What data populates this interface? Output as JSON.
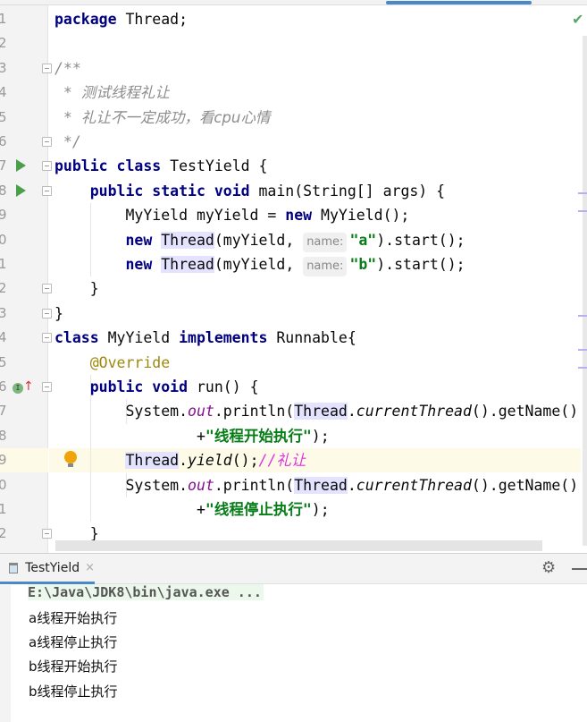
{
  "editor": {
    "line_numbers": [
      "1",
      "2",
      "3",
      "4",
      "5",
      "6",
      "7",
      "8",
      "9",
      "0",
      "1",
      "2",
      "3",
      "4",
      "5",
      "6",
      "7",
      "8",
      "9",
      "0",
      "1",
      "2"
    ],
    "hint_label": "name:",
    "status_icon": "check-icon",
    "lines": [
      [
        {
          "t": "package",
          "c": "kw"
        },
        {
          "t": " Thread;"
        }
      ],
      [],
      [
        {
          "t": "/**",
          "c": "cmk"
        }
      ],
      [
        {
          "t": " * ",
          "c": "cmk"
        },
        {
          "t": "测试线程礼让",
          "c": "cm"
        }
      ],
      [
        {
          "t": " * ",
          "c": "cmk"
        },
        {
          "t": "礼让不一定成功，看cpu心情",
          "c": "cm"
        }
      ],
      [
        {
          "t": " */",
          "c": "cmk"
        }
      ],
      [
        {
          "t": "public class",
          "c": "kw"
        },
        {
          "t": " TestYield {"
        }
      ],
      [
        {
          "t": "    "
        },
        {
          "t": "public static void",
          "c": "kw"
        },
        {
          "t": " main(String[] args) {"
        }
      ],
      [
        {
          "t": "        MyYield myYield = "
        },
        {
          "t": "new",
          "c": "kw"
        },
        {
          "t": " MyYield();"
        }
      ],
      [
        {
          "t": "        "
        },
        {
          "t": "new",
          "c": "kw"
        },
        {
          "t": " "
        },
        {
          "t": "Thread",
          "c": "ty"
        },
        {
          "t": "(myYield, "
        },
        {
          "t": "name:",
          "c": "hint"
        },
        {
          "t": "\"a\"",
          "c": "str"
        },
        {
          "t": ").start();"
        }
      ],
      [
        {
          "t": "        "
        },
        {
          "t": "new",
          "c": "kw"
        },
        {
          "t": " "
        },
        {
          "t": "Thread",
          "c": "ty"
        },
        {
          "t": "(myYield, "
        },
        {
          "t": "name:",
          "c": "hint"
        },
        {
          "t": "\"b\"",
          "c": "str"
        },
        {
          "t": ").start();"
        }
      ],
      [
        {
          "t": "    }"
        }
      ],
      [
        {
          "t": "}"
        }
      ],
      [
        {
          "t": "class",
          "c": "kw"
        },
        {
          "t": " MyYield "
        },
        {
          "t": "implements",
          "c": "kw"
        },
        {
          "t": " Runnable{"
        }
      ],
      [
        {
          "t": "    "
        },
        {
          "t": "@Override",
          "c": "ann"
        }
      ],
      [
        {
          "t": "    "
        },
        {
          "t": "public void",
          "c": "kw"
        },
        {
          "t": " run() {"
        }
      ],
      [
        {
          "t": "        System."
        },
        {
          "t": "out",
          "c": "fld"
        },
        {
          "t": ".println("
        },
        {
          "t": "Thread",
          "c": "ty"
        },
        {
          "t": "."
        },
        {
          "t": "currentThread",
          "c": "mth"
        },
        {
          "t": "().getName()"
        }
      ],
      [
        {
          "t": "                +"
        },
        {
          "t": "\"线程开始执行\"",
          "c": "str"
        },
        {
          "t": ");"
        }
      ],
      [
        {
          "t": "        "
        },
        {
          "t": "Thread",
          "c": "ty"
        },
        {
          "t": "."
        },
        {
          "t": "yield",
          "c": "mth"
        },
        {
          "t": "();"
        },
        {
          "t": "//礼让",
          "c": "lc"
        }
      ],
      [
        {
          "t": "        System."
        },
        {
          "t": "out",
          "c": "fld"
        },
        {
          "t": ".println("
        },
        {
          "t": "Thread",
          "c": "ty"
        },
        {
          "t": "."
        },
        {
          "t": "currentThread",
          "c": "mth"
        },
        {
          "t": "().getName()"
        }
      ],
      [
        {
          "t": "                +"
        },
        {
          "t": "\"线程停止执行\"",
          "c": "str"
        },
        {
          "t": ");"
        }
      ],
      [
        {
          "t": "    }"
        }
      ]
    ]
  },
  "run_panel": {
    "tab_label": "TestYield",
    "close_glyph": "×",
    "command": "E:\\Java\\JDK8\\bin\\java.exe ...",
    "output": [
      "a线程开始执行",
      "a线程停止执行",
      "b线程开始执行",
      "b线程停止执行"
    ]
  },
  "colors": {
    "keyword": "#000080",
    "string": "#067d17",
    "comment": "#8c8c8c",
    "accent": "#4a88c7"
  }
}
